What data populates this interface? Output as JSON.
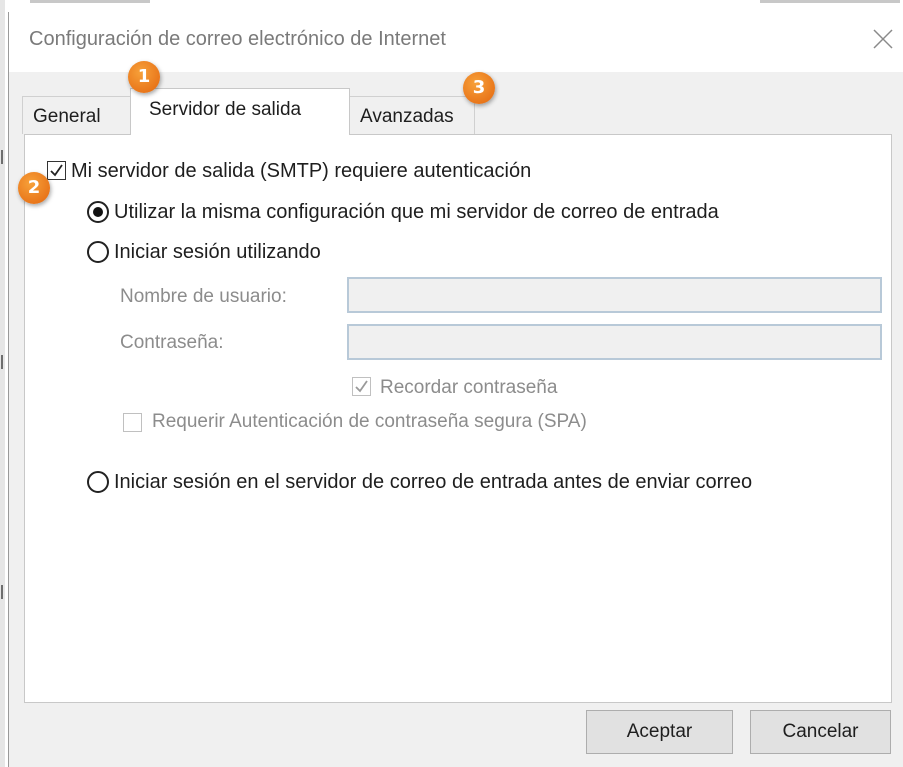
{
  "window": {
    "title": "Configuración de correo electrónico de Internet"
  },
  "tabs": [
    {
      "label": "General"
    },
    {
      "label": "Servidor de salida"
    },
    {
      "label": "Avanzadas"
    }
  ],
  "outgoing": {
    "smtp_auth_label": "Mi servidor de salida (SMTP) requiere autenticación",
    "smtp_auth_checked": true,
    "options": [
      {
        "label": "Utilizar la misma configuración que mi servidor de correo de entrada",
        "selected": true
      },
      {
        "label": "Iniciar sesión utilizando",
        "selected": false
      },
      {
        "label": "Iniciar sesión en el servidor de correo de entrada antes de enviar correo",
        "selected": false
      }
    ],
    "username_label": "Nombre de usuario:",
    "username_value": "",
    "password_label": "Contraseña:",
    "password_value": "",
    "remember_password_label": "Recordar contraseña",
    "remember_password_checked": true,
    "spa_label": "Requerir Autenticación de contraseña segura (SPA)",
    "spa_checked": false
  },
  "buttons": {
    "accept": "Aceptar",
    "cancel": "Cancelar"
  },
  "badges": [
    "1",
    "2",
    "3"
  ],
  "colors": {
    "badge": "#e9771b",
    "field_border": "#b8c9d8",
    "dialog_bg": "#f0f0f0"
  }
}
